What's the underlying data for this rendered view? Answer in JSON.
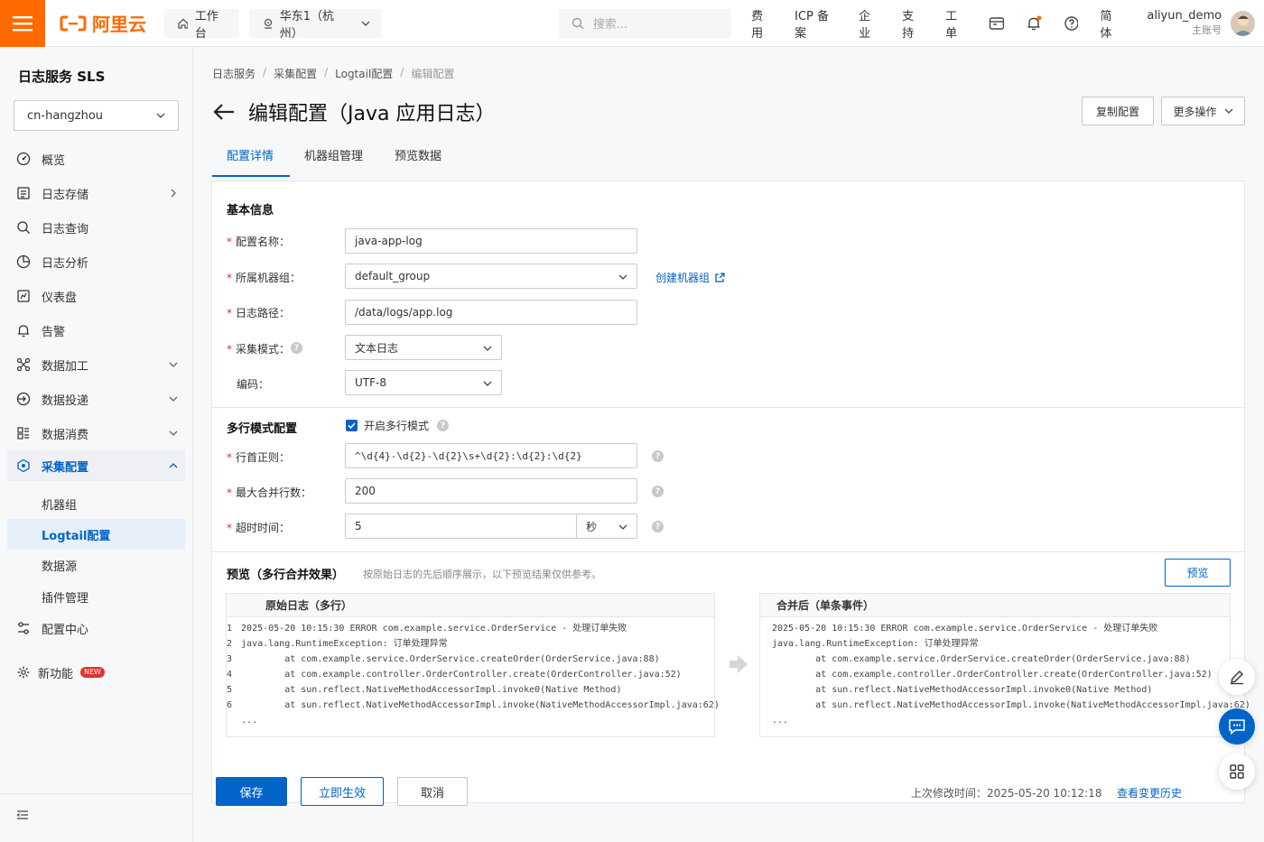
{
  "topbar": {
    "logo_text": "阿里云",
    "workbench": "工作台",
    "region": "华东1（杭州）",
    "search_placeholder": "搜索...",
    "links": [
      "费用",
      "ICP 备案",
      "企业",
      "支持",
      "工单"
    ],
    "lang": "简体",
    "user_name": "aliyun_demo",
    "user_sub": "主账号"
  },
  "sidebar": {
    "title": "日志服务 SLS",
    "region_select": "cn-hangzhou",
    "items": [
      {
        "label": "概览",
        "icon": "overview-icon"
      },
      {
        "label": "日志存储",
        "icon": "storage-icon"
      },
      {
        "label": "日志查询",
        "icon": "search-icon"
      },
      {
        "label": "日志分析",
        "icon": "analysis-icon"
      },
      {
        "label": "仪表盘",
        "icon": "dashboard-icon"
      },
      {
        "label": "告警",
        "icon": "bell-icon"
      },
      {
        "label": "数据加工",
        "icon": "processing-icon"
      },
      {
        "label": "数据投递",
        "icon": "delivery-icon"
      },
      {
        "label": "数据消费",
        "icon": "consume-icon"
      },
      {
        "label": "采集配置",
        "icon": "collect-icon"
      }
    ],
    "sub_items": [
      "机器组",
      "Logtail配置",
      "数据源",
      "插件管理"
    ],
    "config_center": "配置中心",
    "new_feature": "新功能",
    "new_badge": "NEW"
  },
  "breadcrumb": [
    "日志服务",
    "采集配置",
    "Logtail配置",
    "编辑配置"
  ],
  "page": {
    "title": "编辑配置（Java 应用日志）",
    "copy_btn": "复制配置",
    "more_btn": "更多操作"
  },
  "tabs": [
    "配置详情",
    "机器组管理",
    "预览数据"
  ],
  "basic": {
    "title": "基本信息",
    "name_label": "配置名称：",
    "name_value": "java-app-log",
    "group_label": "所属机器组：",
    "group_value": "default_group",
    "create_group": "创建机器组",
    "path_label": "日志路径：",
    "path_value": "/data/logs/app.log",
    "mode_label": "采集模式：",
    "mode_value": "文本日志",
    "encoding_label": "编码：",
    "encoding_value": "UTF-8"
  },
  "multiline": {
    "title": "多行模式配置",
    "enable_label": "开启多行模式",
    "enabled": true,
    "regex_label": "行首正则：",
    "regex_value": "^\\d{4}-\\d{2}-\\d{2}\\s+\\d{2}:\\d{2}:\\d{2}",
    "maxlines_label": "最大合并行数：",
    "maxlines_value": "200",
    "timeout_label": "超时时间：",
    "timeout_value": "5",
    "timeout_unit": "秒"
  },
  "preview": {
    "title": "预览（多行合并效果）",
    "hint": "按原始日志的先后顺序展示，以下预览结果仅供参考。",
    "btn": "预览",
    "raw_title": "原始日志（多行）",
    "merged_title": "合并后（单条事件）",
    "line_numbers": [
      "1",
      "2",
      "3",
      "4",
      "5",
      "6"
    ],
    "lines": [
      "2025-05-20 10:15:30 ERROR com.example.service.OrderService - 处理订单失败",
      "java.lang.RuntimeException: 订单处理异常",
      "  \tat com.example.service.OrderService.createOrder(OrderService.java:88)",
      "  \tat com.example.controller.OrderController.create(OrderController.java:52)",
      "  \tat sun.reflect.NativeMethodAccessorImpl.invoke0(Native Method)",
      "  \tat sun.reflect.NativeMethodAccessorImpl.invoke(NativeMethodAccessorImpl.java:62)"
    ],
    "ellipsis": "..."
  },
  "footer": {
    "save": "保存",
    "apply": "立即生效",
    "cancel": "取消",
    "last_modified": "上次修改时间：2025-05-20 10:12:18",
    "history": "查看变更历史"
  },
  "colors": {
    "brand": "#ff6a00",
    "primary": "#0064c8",
    "required": "#e0322c"
  }
}
